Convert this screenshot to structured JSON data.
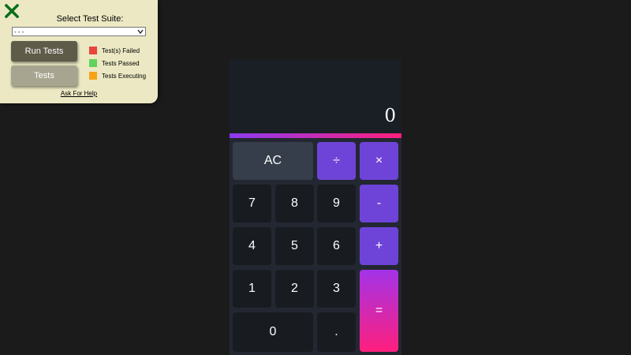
{
  "test_panel": {
    "close_icon": "close-x-icon",
    "suite_label": "Select Test Suite:",
    "suite_select_value": "- - -",
    "run_button": "Run Tests",
    "tests_button": "Tests",
    "legend": [
      {
        "label": "Test(s) Failed",
        "color": "#e8453c"
      },
      {
        "label": "Tests Passed",
        "color": "#5fd35b"
      },
      {
        "label": "Tests Executing",
        "color": "#f5a316"
      }
    ],
    "help_link": "Ask For Help"
  },
  "calculator": {
    "display": "0",
    "keys": {
      "clear": "AC",
      "divide": "÷",
      "multiply": "×",
      "seven": "7",
      "eight": "8",
      "nine": "9",
      "subtract": "-",
      "four": "4",
      "five": "5",
      "six": "6",
      "add": "+",
      "one": "1",
      "two": "2",
      "three": "3",
      "equals": "=",
      "zero": "0",
      "decimal": "."
    }
  }
}
